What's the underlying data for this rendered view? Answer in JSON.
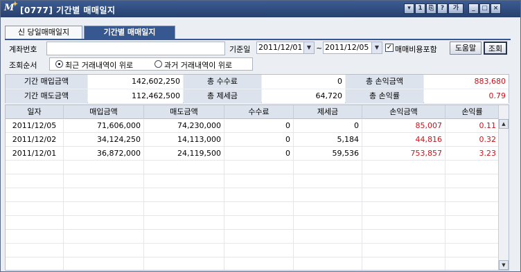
{
  "window": {
    "title": "[0777] 기간별 매매일지"
  },
  "titlebar_buttons": [
    "▾",
    "1",
    "⎘",
    "?",
    "가",
    "_",
    "□",
    "×"
  ],
  "tabs": [
    {
      "label": "신 당일매매일지",
      "active": false
    },
    {
      "label": "기간별 매매일지",
      "active": true
    }
  ],
  "filters": {
    "account_label": "계좌번호",
    "account_value": "",
    "base_date_label": "기준일",
    "start_date": "2011/12/01",
    "tilde": "~",
    "end_date": "2011/12/05",
    "fee_checkbox_label": "매매비용포함",
    "fee_checkbox_checked": true,
    "help_button": "도움말",
    "search_button": "조회",
    "order_label": "조회순서",
    "order_options": [
      {
        "label": "최근 거래내역이 위로",
        "selected": true
      },
      {
        "label": "과거 거래내역이 위로",
        "selected": false
      }
    ]
  },
  "summary": {
    "buy_label": "기간 매입금액",
    "buy_value": "142,602,250",
    "fee_label": "총 수수료",
    "fee_value": "0",
    "pnl_label": "총 손익금액",
    "pnl_value": "883,680",
    "sell_label": "기간 매도금액",
    "sell_value": "112,462,500",
    "tax_label": "총 제세금",
    "tax_value": "64,720",
    "rate_label": "총 손익률",
    "rate_value": "0.79"
  },
  "table": {
    "headers": [
      "일자",
      "매입금액",
      "매도금액",
      "수수료",
      "제세금",
      "손익금액",
      "손익률"
    ],
    "rows": [
      [
        "2011/12/05",
        "71,606,000",
        "74,230,000",
        "0",
        "0",
        "85,007",
        "0.11"
      ],
      [
        "2011/12/02",
        "34,124,250",
        "14,113,000",
        "0",
        "5,184",
        "44,816",
        "0.32"
      ],
      [
        "2011/12/01",
        "36,872,000",
        "24,119,500",
        "0",
        "59,536",
        "753,857",
        "3.23"
      ]
    ],
    "empty_rows": 8
  },
  "colors": {
    "profit": "#c4141c",
    "title_bar": "#27406e",
    "active_tab": "#36578f"
  }
}
